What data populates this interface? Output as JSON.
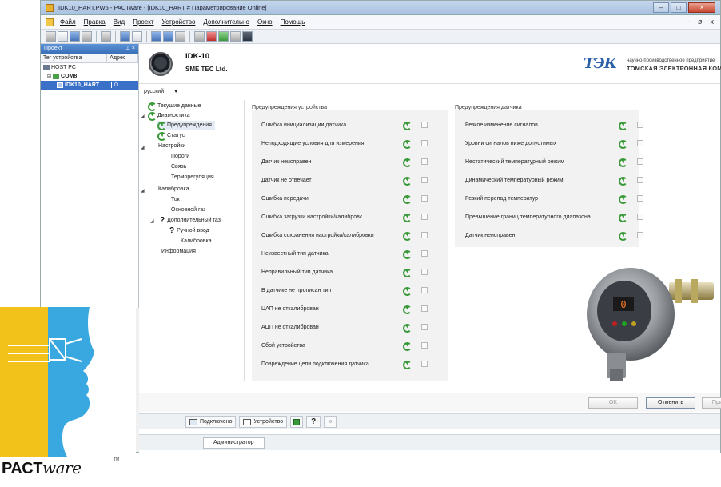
{
  "window": {
    "title": "IDK10_HART.PW5 - PACTware - [IDK10_HART # Параметрирование Online]"
  },
  "menu": {
    "items": [
      "Файл",
      "Правка",
      "Вид",
      "Проект",
      "Устройство",
      "Дополнительно",
      "Окно",
      "Помощь"
    ],
    "mdi_controls": [
      "-",
      "Ɖ",
      "x"
    ]
  },
  "project_panel": {
    "title": "Проект",
    "columns": [
      "Тег устройства",
      "Адрес"
    ],
    "tree": [
      {
        "label": "HOST PC",
        "level": 0,
        "selected": false
      },
      {
        "label": "COM8",
        "level": 1,
        "selected": false
      },
      {
        "label": "IDK10_HART",
        "level": 2,
        "selected": true,
        "address": "0"
      }
    ]
  },
  "device_header": {
    "device_name": "IDK-10",
    "manufacturer": "SME TEC Ltd.",
    "company_logo_text": "ТЭК",
    "company_line1": "научно-производственное предприятие",
    "company_line2": "ТОМСКАЯ ЭЛЕКТРОННАЯ КОМПАНИЯ"
  },
  "language": {
    "selected": "русский"
  },
  "nav_tree": {
    "items": [
      {
        "label": "Текущие данные",
        "icon": "refresh-icon"
      },
      {
        "label": "Диагностика",
        "icon": "refresh-icon"
      },
      {
        "label": "Предупреждения",
        "icon": "refresh-icon"
      },
      {
        "label": "Статус",
        "icon": "refresh-icon"
      },
      {
        "label": "Настройки",
        "icon": ""
      },
      {
        "label": "Пороги",
        "icon": ""
      },
      {
        "label": "Связь",
        "icon": ""
      },
      {
        "label": "Терморегуляция",
        "icon": ""
      },
      {
        "label": "Калибровка",
        "icon": ""
      },
      {
        "label": "Ток",
        "icon": ""
      },
      {
        "label": "Основной газ",
        "icon": ""
      },
      {
        "label": "Дополнительный газ",
        "icon": "question-icon"
      },
      {
        "label": "Ручной ввод",
        "icon": "question-icon"
      },
      {
        "label": "Калибровка",
        "icon": ""
      },
      {
        "label": "Информация",
        "icon": ""
      }
    ]
  },
  "device_warnings": {
    "title": "Предупреждения устройства",
    "rows": [
      "Ошибка инициализации датчика",
      "Неподходящие условия для измерения",
      "Датчик неисправен",
      "Датчик не отвечает",
      "Ошибка передачи",
      "Ошибка загрузки настройки/калибровк",
      "Ошибка сохранения настройки/калибровки",
      "Неизвестный тип датчика",
      "Неправильный тип датчика",
      "В датчике не прописан тип",
      "ЦАП не откалиброван",
      "АЦП не откалиброван",
      "Сбой устройства",
      "Повреждение цепи подключения датчика"
    ]
  },
  "sensor_warnings": {
    "title": "Предупреждения датчика",
    "rows": [
      "Резкое изменение сигналов",
      "Уровни сигналов ниже допустимых",
      "Нестатический температурный режим",
      "Динамический температурный режим",
      "Резкий перепад температур",
      "Превышение границ температурного диапазона",
      "Датчик неисправен"
    ]
  },
  "buttons": {
    "ok": "OK",
    "cancel": "Отменить",
    "apply": "Применить"
  },
  "status_bar": {
    "connected": "Подключено",
    "device": "Устройство"
  },
  "user_bar": {
    "role": "Администратор"
  },
  "brand": {
    "name_bold": "PACT",
    "name_italic": "ware",
    "tm": "TM"
  },
  "colors": {
    "accent_green": "#3a9a3a",
    "selection_blue": "#3a70c8",
    "brand_blue": "#2b5fa8",
    "logo_yellow": "#f2c21a",
    "logo_cyan": "#3aa8e0"
  }
}
